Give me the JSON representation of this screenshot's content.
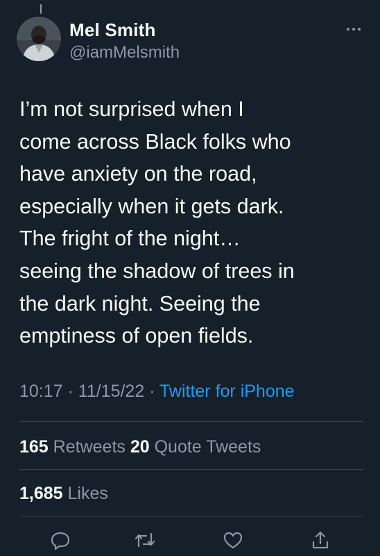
{
  "author": {
    "name": "Mel Smith",
    "handle": "@iamMelsmith"
  },
  "tweet": {
    "text": "I’m not surprised when I\ncome across Black folks who\nhave anxiety on the road,\nespecially when it gets dark.\nThe fright of the night…\nseeing the shadow of trees in\nthe dark night. Seeing the\nemptiness of open fields."
  },
  "meta": {
    "time": "10:17",
    "sep1": " · ",
    "date": "11/15/22",
    "sep2": " · ",
    "source": "Twitter for iPhone"
  },
  "stats": {
    "retweets_count": "165",
    "retweets_label": "Retweets",
    "quotes_count": "20",
    "quotes_label": "Quote Tweets",
    "likes_count": "1,685",
    "likes_label": "Likes"
  },
  "icons": {
    "more": "more-dots-icon",
    "reply": "reply-icon",
    "retweet": "retweet-icon",
    "like": "heart-icon",
    "share": "share-icon"
  },
  "colors": {
    "background": "#15202b",
    "primary_text": "#f7f9f9",
    "secondary_text": "#8b98a5",
    "link": "#1d9bf0",
    "divider": "#38444d"
  }
}
